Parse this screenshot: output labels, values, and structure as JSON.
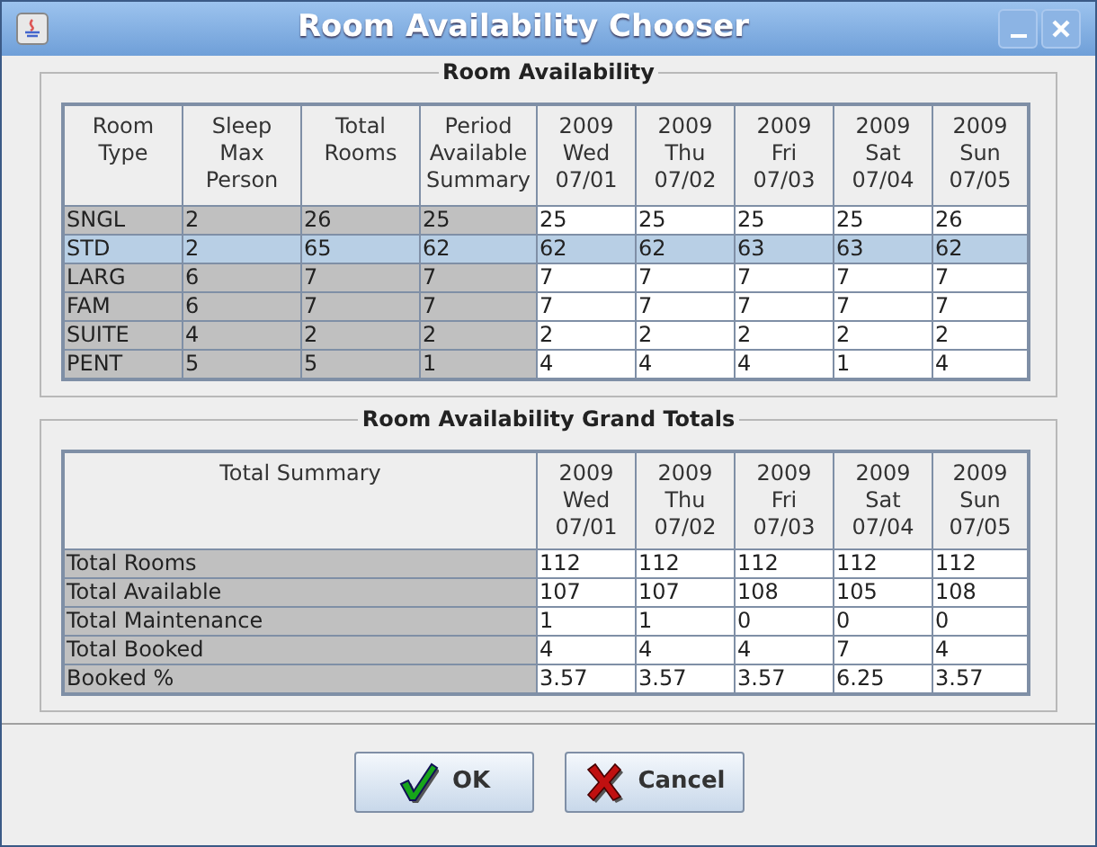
{
  "window": {
    "title": "Room Availability Chooser"
  },
  "availability": {
    "title": "Room Availability",
    "columns": [
      {
        "lines": [
          "Room",
          "Type"
        ]
      },
      {
        "lines": [
          "Sleep",
          "Max",
          "Person"
        ]
      },
      {
        "lines": [
          "Total",
          "Rooms"
        ]
      },
      {
        "lines": [
          "Period",
          "Available",
          "Summary"
        ]
      },
      {
        "lines": [
          "2009",
          "Wed",
          "07/01"
        ]
      },
      {
        "lines": [
          "2009",
          "Thu",
          "07/02"
        ]
      },
      {
        "lines": [
          "2009",
          "Fri",
          "07/03"
        ]
      },
      {
        "lines": [
          "2009",
          "Sat",
          "07/04"
        ]
      },
      {
        "lines": [
          "2009",
          "Sun",
          "07/05"
        ]
      }
    ],
    "rows": [
      {
        "selected": false,
        "cells": [
          "SNGL",
          "2",
          "26",
          "25",
          "25",
          "25",
          "25",
          "25",
          "26"
        ]
      },
      {
        "selected": true,
        "cells": [
          "STD",
          "2",
          "65",
          "62",
          "62",
          "62",
          "63",
          "63",
          "62"
        ]
      },
      {
        "selected": false,
        "cells": [
          "LARG",
          "6",
          "7",
          "7",
          "7",
          "7",
          "7",
          "7",
          "7"
        ]
      },
      {
        "selected": false,
        "cells": [
          "FAM",
          "6",
          "7",
          "7",
          "7",
          "7",
          "7",
          "7",
          "7"
        ]
      },
      {
        "selected": false,
        "cells": [
          "SUITE",
          "4",
          "2",
          "2",
          "2",
          "2",
          "2",
          "2",
          "2"
        ]
      },
      {
        "selected": false,
        "cells": [
          "PENT",
          "5",
          "5",
          "1",
          "4",
          "4",
          "4",
          "1",
          "4"
        ]
      }
    ]
  },
  "grand_totals": {
    "title": "Room Availability Grand Totals",
    "columns": [
      {
        "lines": [
          "Total Summary"
        ]
      },
      {
        "lines": [
          "2009",
          "Wed",
          "07/01"
        ]
      },
      {
        "lines": [
          "2009",
          "Thu",
          "07/02"
        ]
      },
      {
        "lines": [
          "2009",
          "Fri",
          "07/03"
        ]
      },
      {
        "lines": [
          "2009",
          "Sat",
          "07/04"
        ]
      },
      {
        "lines": [
          "2009",
          "Sun",
          "07/05"
        ]
      }
    ],
    "rows": [
      {
        "cells": [
          "Total Rooms",
          "112",
          "112",
          "112",
          "112",
          "112"
        ]
      },
      {
        "cells": [
          "Total Available",
          "107",
          "107",
          "108",
          "105",
          "108"
        ]
      },
      {
        "cells": [
          "Total Maintenance",
          "1",
          "1",
          "0",
          "0",
          "0"
        ]
      },
      {
        "cells": [
          "Total Booked",
          "4",
          "4",
          "4",
          "7",
          "4"
        ]
      },
      {
        "cells": [
          "Booked %",
          "3.57",
          "3.57",
          "3.57",
          "6.25",
          "3.57"
        ]
      }
    ]
  },
  "buttons": [
    {
      "kind": "ok",
      "label": "OK"
    },
    {
      "kind": "cancel",
      "label": "Cancel"
    }
  ]
}
